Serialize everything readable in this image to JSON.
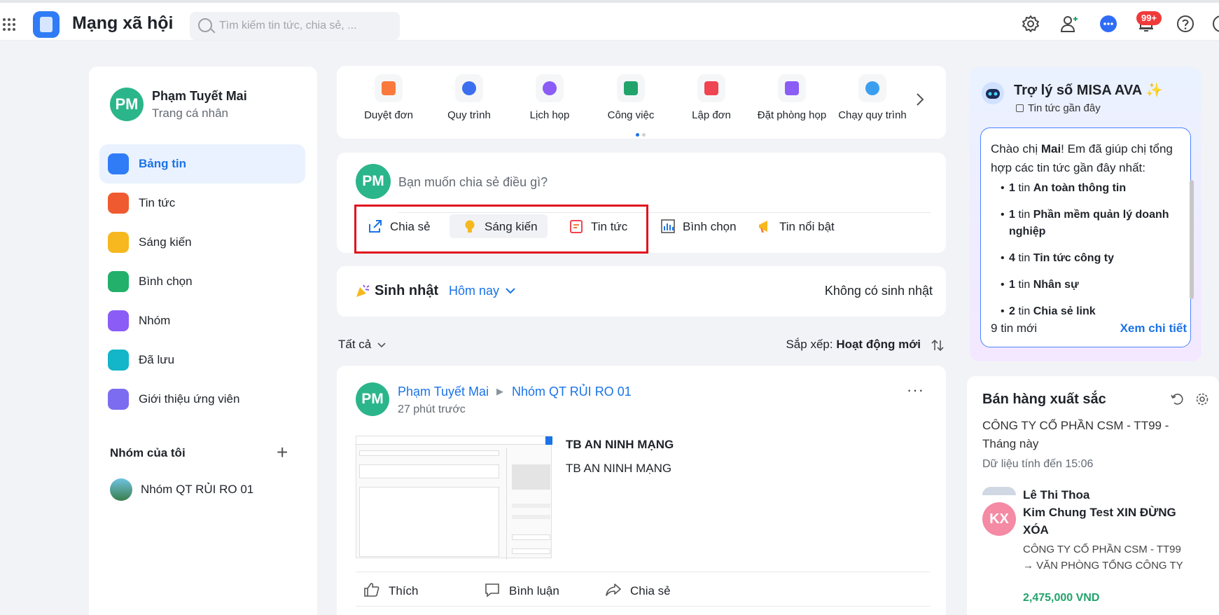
{
  "topbar": {
    "app_title": "Mạng xã hội",
    "search_placeholder": "Tìm kiếm tin tức, chia sẻ, ...",
    "notification_badge": "99+"
  },
  "profile": {
    "initials": "PM",
    "name": "Phạm Tuyết Mai",
    "subtitle": "Trang cá nhân"
  },
  "nav": [
    {
      "label": "Bảng tin",
      "color": "#2f7cf6"
    },
    {
      "label": "Tin tức",
      "color": "#f05a30"
    },
    {
      "label": "Sáng kiến",
      "color": "#f6b81e"
    },
    {
      "label": "Bình chọn",
      "color": "#22b06a"
    },
    {
      "label": "Nhóm",
      "color": "#8b5cf6"
    },
    {
      "label": "Đã lưu",
      "color": "#13b5c8"
    },
    {
      "label": "Giới thiệu ứng viên",
      "color": "#7c6cf0"
    }
  ],
  "my_groups": {
    "title": "Nhóm của tôi",
    "items": [
      "Nhóm QT RỦI RO 01"
    ]
  },
  "quick_actions": [
    {
      "label": "Duyệt đơn",
      "color": "#f97a3c"
    },
    {
      "label": "Quy trình",
      "color": "#3b6ff0"
    },
    {
      "label": "Lịch họp",
      "color": "#8b5cf6"
    },
    {
      "label": "Công việc",
      "color": "#22a36a"
    },
    {
      "label": "Lập đơn",
      "color": "#ef4452"
    },
    {
      "label": "Đặt phòng họp",
      "color": "#8b5cf6"
    },
    {
      "label": "Chạy quy trình",
      "color": "#3b9ff0"
    }
  ],
  "composer": {
    "initials": "PM",
    "placeholder": "Bạn muốn chia sẻ điều gì?",
    "actions": [
      "Chia sẻ",
      "Sáng kiến",
      "Tin tức",
      "Bình chọn",
      "Tin nổi bật"
    ]
  },
  "birthday": {
    "title": "Sinh nhật",
    "filter": "Hôm nay",
    "empty": "Không có sinh nhật"
  },
  "feed_filter": {
    "all": "Tất cả",
    "sort_label": "Sắp xếp:",
    "sort_value": "Hoạt động mới"
  },
  "post": {
    "initials": "PM",
    "author": "Phạm Tuyết Mai",
    "group": "Nhóm QT RỦI RO 01",
    "time": "27 phút trước",
    "title": "TB AN NINH MẠNG",
    "body": "TB AN NINH MẠNG",
    "like": "Thích",
    "comment": "Bình luận",
    "share": "Chia sẻ"
  },
  "assistant": {
    "title": "Trợ lý số MISA AVA ✨",
    "subtitle": "Tin tức gần đây",
    "greeting_pre": "Chào chị ",
    "greeting_name": "Mai",
    "greeting_post": "! Em đã giúp chị tổng hợp các tin tức gần đây nhất:",
    "items": [
      {
        "count": "1",
        "unit": "tin",
        "topic": "An toàn thông tin"
      },
      {
        "count": "1",
        "unit": "tin",
        "topic": "Phần mềm quản lý doanh nghiệp"
      },
      {
        "count": "4",
        "unit": "tin",
        "topic": "Tin tức công ty"
      },
      {
        "count": "1",
        "unit": "tin",
        "topic": "Nhân sự"
      },
      {
        "count": "2",
        "unit": "tin",
        "topic": "Chia sẻ link"
      }
    ],
    "new_count": "9",
    "new_label": "tin mới",
    "detail_link": "Xem chi tiết"
  },
  "sales": {
    "title": "Bán hàng xuất sắc",
    "company": "CÔNG TY CỔ PHẦN CSM - TT99 - Tháng này",
    "updated": "Dữ liệu tính đến 15:06",
    "top_name": "Lê Thi Thoa",
    "rep_initials": "KX",
    "rep_name": "Kim Chung Test XIN ĐỪNG XÓA",
    "rep_org": "CÔNG TY CỔ PHẦN CSM - TT99 → VĂN PHÒNG TỔNG CÔNG TY",
    "rep_amount": "2,475,000 VND"
  }
}
